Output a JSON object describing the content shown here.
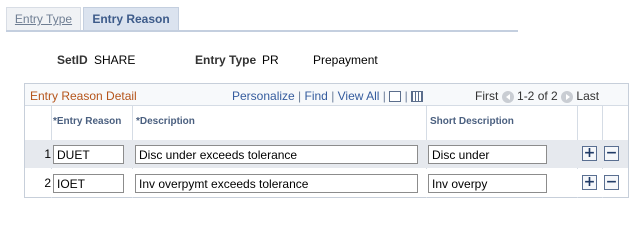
{
  "tabs": [
    {
      "label": "Entry Type",
      "active": false
    },
    {
      "label": "Entry Reason",
      "active": true
    }
  ],
  "header": {
    "setid_label": "SetID",
    "setid_value": "SHARE",
    "entry_type_label": "Entry Type",
    "entry_type_value": "PR",
    "entry_type_desc": "Prepayment"
  },
  "grid": {
    "title": "Entry Reason Detail",
    "personalize": "Personalize",
    "find": "Find",
    "view_all": "View All",
    "first": "First",
    "range": "1-2 of 2",
    "last": "Last",
    "columns": {
      "entry_reason": "*Entry Reason",
      "description": "*Description",
      "short_description": "Short Description"
    },
    "rows": [
      {
        "num": "1",
        "entry_reason": "DUET",
        "description": "Disc under exceeds tolerance",
        "short_description": "Disc under"
      },
      {
        "num": "2",
        "entry_reason": "IOET",
        "description": "Inv overpymt exceeds tolerance",
        "short_description": "Inv overpy"
      }
    ],
    "add_label": "+",
    "delete_label": "−"
  }
}
